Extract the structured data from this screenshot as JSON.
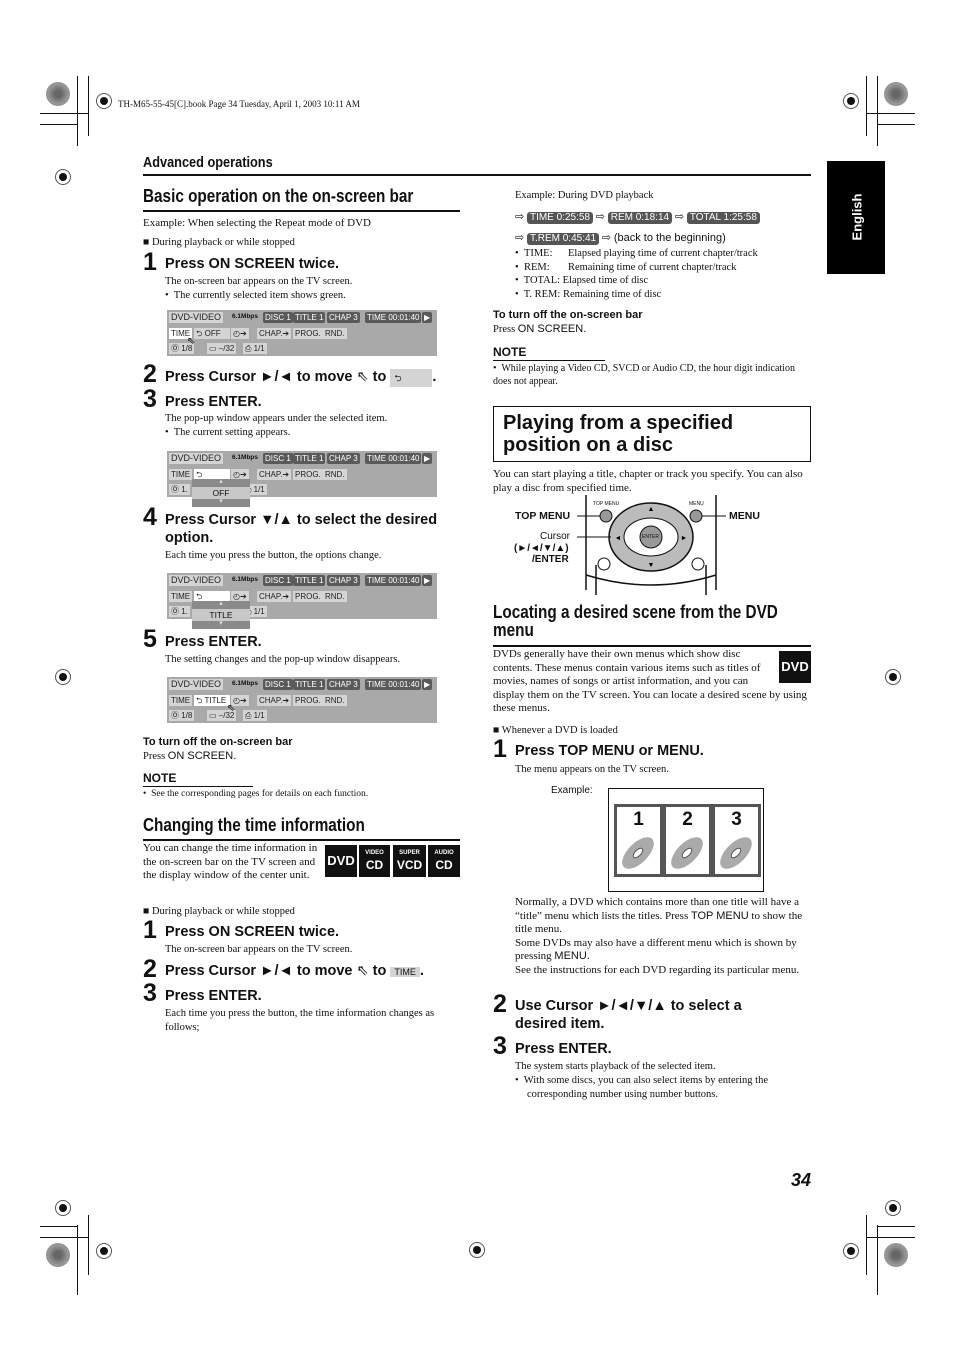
{
  "print_slug": "TH-M65-55-45[C].book  Page 34  Tuesday, April 1, 2003  10:11 AM",
  "section_header": "Advanced operations",
  "language_tab": "English",
  "page_number": "34",
  "left": {
    "basic": {
      "title": "Basic operation on the on-screen bar",
      "example": "Example: When selecting the Repeat mode of DVD",
      "condition": "During playback or while stopped",
      "steps": [
        {
          "num": "1",
          "text": "Press ON SCREEN twice.",
          "desc": "The on-screen bar appears on the TV screen.",
          "bullet": "The currently selected item shows green."
        },
        {
          "num": "2",
          "text_a": "Press Cursor ►/◄ to move",
          "text_b": "to",
          "target": "⮌"
        },
        {
          "num": "3",
          "text": "Press ENTER.",
          "desc": "The pop-up window appears under the selected item.",
          "bullet": "The current setting appears."
        },
        {
          "num": "4",
          "text": "Press Cursor ▼/▲ to select the desired option.",
          "desc": "Each time you press the button, the options change."
        },
        {
          "num": "5",
          "text": "Press ENTER.",
          "desc": "The setting changes and the pop-up window disappears."
        }
      ],
      "turn_off_title": "To turn off the on-screen bar",
      "turn_off_press": "Press",
      "turn_off_key": "ON SCREEN.",
      "note_label": "NOTE",
      "note": "See the corresponding pages for details on each function."
    },
    "osb": {
      "source": "DVD-VIDEO",
      "bitrate": "6.1Mbps",
      "disc": "DISC 1",
      "title": "TITLE  1",
      "chap": "CHAP  3",
      "time": "TIME 00:01:40",
      "play": "▶",
      "time_btn": "TIME",
      "repeat_off": "⮌ OFF",
      "repeat_title": "⮌ TITLE",
      "repeat_blank": "⮌",
      "ab": "◴➔",
      "chap_btn": "CHAP.➔",
      "prog": "PROG.",
      "rnd": "RND.",
      "audio": "Ⓞ 1/8",
      "audio_short": "Ⓞ 1.",
      "subtitle": "▭ –/32",
      "angle": "⎙ 1/1",
      "popup_off": "OFF",
      "popup_title": "TITLE",
      "arrow_up": "▴",
      "arrow_down": "▾"
    },
    "time_info": {
      "title": "Changing the time information",
      "intro": "You can change the time information in the on-screen bar on the TV screen and the display window of the center unit.",
      "badges": [
        {
          "top": "",
          "main": "DVD"
        },
        {
          "top": "VIDEO",
          "main": "CD"
        },
        {
          "top": "SUPER",
          "main": "VCD"
        },
        {
          "top": "AUDIO",
          "main": "CD"
        }
      ],
      "condition": "During playback or while stopped",
      "steps": [
        {
          "num": "1",
          "text": "Press ON SCREEN twice.",
          "desc": "The on-screen bar appears on the TV screen."
        },
        {
          "num": "2",
          "text_a": "Press Cursor ►/◄ to move",
          "text_b": "to",
          "target": "TIME"
        },
        {
          "num": "3",
          "text": "Press ENTER.",
          "desc": "Each time you press the button, the time information changes as follows;"
        }
      ]
    }
  },
  "right": {
    "time_example": "Example: During DVD playback",
    "time_sequence": [
      "TIME  0:25:58",
      "REM  0:18:14",
      "TOTAL  1:25:58",
      "T.REM 0:45:41"
    ],
    "back_text": "(back to the beginning)",
    "definitions": [
      {
        "term": "TIME:",
        "def": "Elapsed playing time of current chapter/track"
      },
      {
        "term": "REM:",
        "def": "Remaining time of current chapter/track"
      },
      {
        "term": "TOTAL:",
        "def": "Elapsed time of disc"
      },
      {
        "term": "T. REM:",
        "def": "Remaining time of disc"
      }
    ],
    "turn_off_title": "To turn off the on-screen bar",
    "turn_off_press": "Press",
    "turn_off_key": "ON SCREEN.",
    "note_label": "NOTE",
    "note": "While playing a Video CD, SVCD or Audio CD, the hour digit indication does not appear.",
    "playing": {
      "title_line1": "Playing from a specified",
      "title_line2": "position on a disc",
      "intro": "You can start playing a title, chapter or track you specify. You can also play a disc from specified time.",
      "remote_labels": {
        "top_menu": "TOP MENU",
        "menu": "MENU",
        "cursor": "Cursor",
        "cursor_keys": "(►/◄/▼/▲)",
        "enter": "/ENTER",
        "btn_top_menu": "TOP MENU",
        "btn_menu": "MENU",
        "btn_enter": "ENTER"
      }
    },
    "locating": {
      "title_line1": "Locating a desired scene from the DVD",
      "title_line2": "menu",
      "badge": "DVD",
      "intro": "DVDs generally have their own menus which show disc contents. These menus contain various items such as titles of movies, names of songs or artist information, and you can display them on the TV screen. You can locate a desired scene by using these menus.",
      "condition": "Whenever a DVD is loaded",
      "step1_num": "1",
      "step1": "Press TOP MENU or MENU.",
      "step1_desc": "The menu appears on the TV screen.",
      "example_label": "Example:",
      "menu_items": [
        "1",
        "2",
        "3"
      ],
      "para1_a": "Normally, a DVD which contains more than one title will have a “title” menu which lists the titles. Press",
      "para1_key": "TOP MENU",
      "para1_b": "to show the title menu.",
      "para2_a": "Some DVDs may also have a different menu which is shown by pressing",
      "para2_key": "MENU",
      "para2_b": ".",
      "para3": "See the instructions for each DVD regarding its particular menu.",
      "step2_num": "2",
      "step2": "Use Cursor ►/◄/▼/▲ to select a desired item.",
      "step3_num": "3",
      "step3": "Press ENTER.",
      "step3_desc": "The system starts playback of the selected item.",
      "step3_bullet": "With some discs, you can also select items by entering the corresponding number using number buttons."
    }
  }
}
